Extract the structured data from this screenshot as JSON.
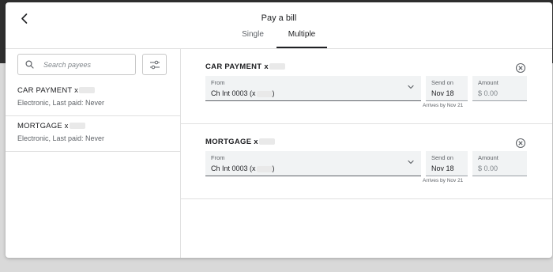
{
  "header": {
    "title": "Pay a bill",
    "tabs": [
      {
        "label": "Single",
        "active": false
      },
      {
        "label": "Multiple",
        "active": true
      }
    ]
  },
  "sidebar": {
    "search": {
      "placeholder": "Search payees",
      "value": ""
    },
    "payees": [
      {
        "name": "CAR PAYMENT x",
        "subtitle": "Electronic, Last paid: Never"
      },
      {
        "name": "MORTGAGE x",
        "subtitle": "Electronic, Last paid: Never"
      }
    ]
  },
  "main": {
    "payments": [
      {
        "payee": "CAR PAYMENT x",
        "from_label": "From",
        "from_value": "Ch Int 0003 (x",
        "from_suffix": ")",
        "send_on_label": "Send on",
        "send_on_value": "Nov 18",
        "amount_label": "Amount",
        "amount_placeholder": "$ 0.00",
        "arrives": "Arrives by Nov 21"
      },
      {
        "payee": "MORTGAGE x",
        "from_label": "From",
        "from_value": "Ch Int 0003 (x",
        "from_suffix": ")",
        "send_on_label": "Send on",
        "send_on_value": "Nov 18",
        "amount_label": "Amount",
        "amount_placeholder": "$ 0.00",
        "arrives": "Arrives by Nov 21"
      }
    ]
  },
  "icons": {
    "back": "chevron-left-icon",
    "search": "search-icon",
    "filter": "sliders-icon",
    "close": "close-circle-icon",
    "dropdown": "chevron-down-icon"
  },
  "colors": {
    "accent": "#202124",
    "field_bg": "#f1f3f4",
    "divider": "#e0e0e0",
    "muted_text": "#5f6368"
  }
}
